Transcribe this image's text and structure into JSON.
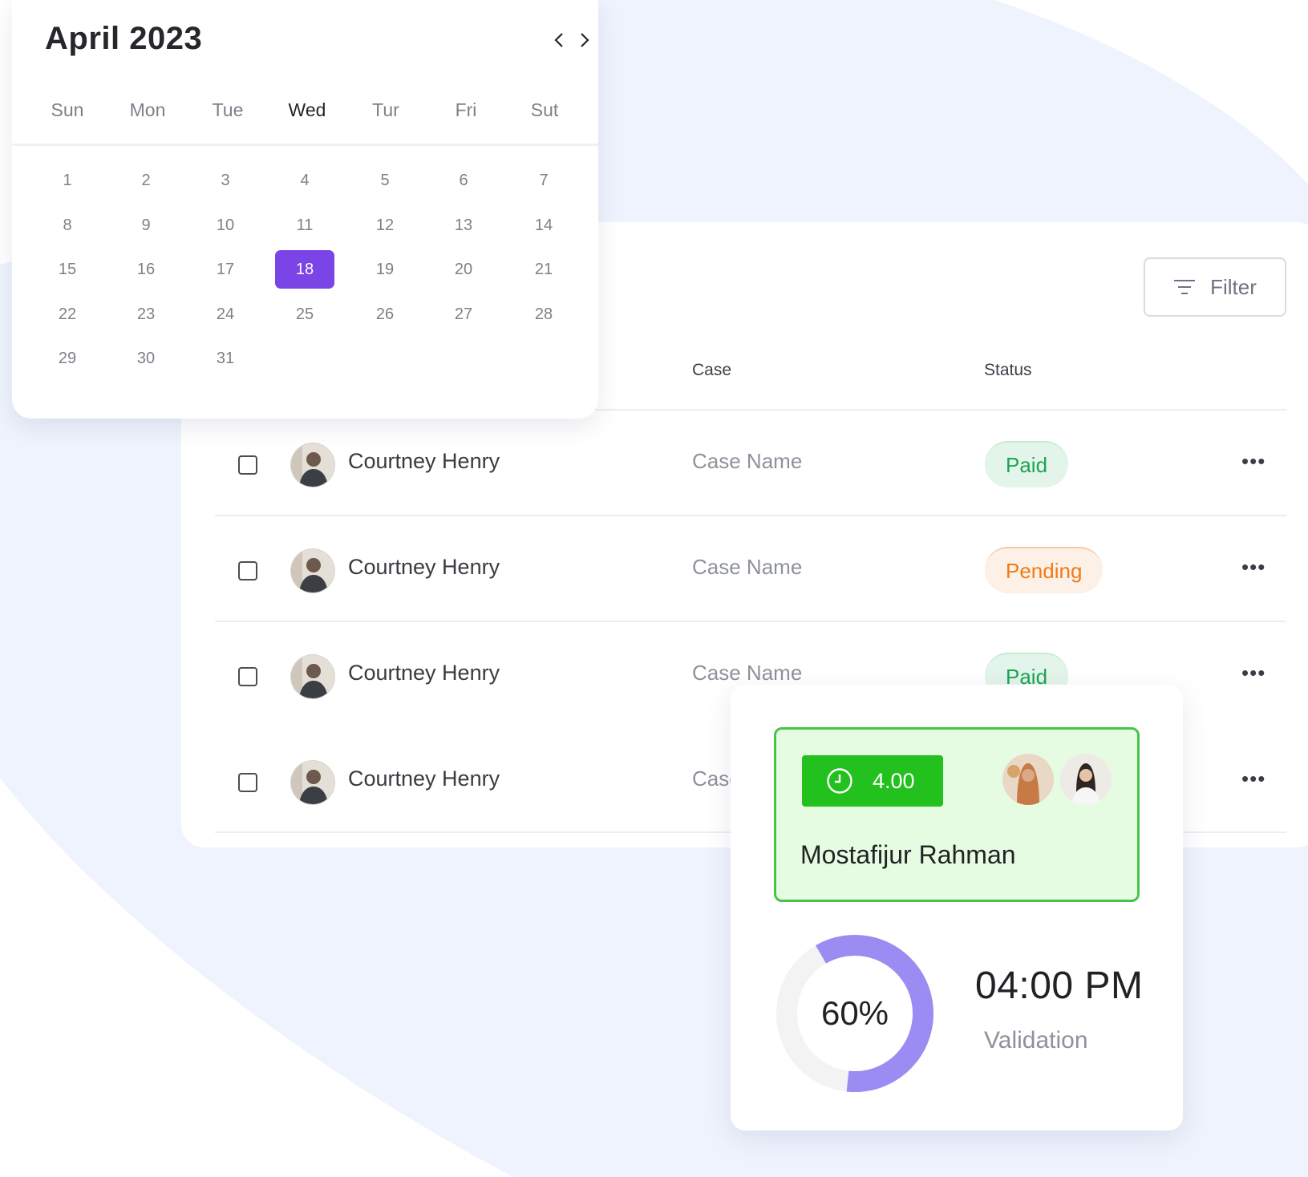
{
  "colors": {
    "accent_purple": "#7b44e6",
    "ring_purple": "#9a8cf2",
    "paid_green": "#1ea552",
    "pending_orange": "#f07a1a",
    "time_badge_green": "#22c11d",
    "background_blob": "#eff3fd"
  },
  "calendar": {
    "title": "April 2023",
    "prev_icon": "chevron-left-icon",
    "next_icon": "chevron-right-icon",
    "weekdays": [
      "Sun",
      "Mon",
      "Tue",
      "Wed",
      "Tur",
      "Fri",
      "Sut"
    ],
    "active_weekday_index": 3,
    "days": [
      "1",
      "2",
      "3",
      "4",
      "5",
      "6",
      "7",
      "8",
      "9",
      "10",
      "11",
      "12",
      "13",
      "14",
      "15",
      "16",
      "17",
      "18",
      "19",
      "20",
      "21",
      "22",
      "23",
      "24",
      "25",
      "26",
      "27",
      "28",
      "29",
      "30",
      "31"
    ],
    "selected_day": "18"
  },
  "table": {
    "filter_label": "Filter",
    "filter_icon": "filter-icon",
    "columns": {
      "case": "Case",
      "status": "Status"
    },
    "rows": [
      {
        "name": "Courtney Henry",
        "case": "Case Name",
        "status": "Paid",
        "status_type": "paid"
      },
      {
        "name": "Courtney Henry",
        "case": "Case Name",
        "status": "Pending",
        "status_type": "pending"
      },
      {
        "name": "Courtney Henry",
        "case": "Case Name",
        "status": "Paid",
        "status_type": "paid"
      },
      {
        "name": "Courtney Henry",
        "case": "Case Name",
        "status": "",
        "status_type": ""
      }
    ],
    "row_menu_label": "•••"
  },
  "card": {
    "time_value": "4.00",
    "clock_icon": "clock-icon",
    "assignee_name": "Mostafijur Rahman",
    "progress_label": "60%",
    "progress_fraction": 0.6,
    "time": "04:00 PM",
    "time_label": "Validation"
  }
}
